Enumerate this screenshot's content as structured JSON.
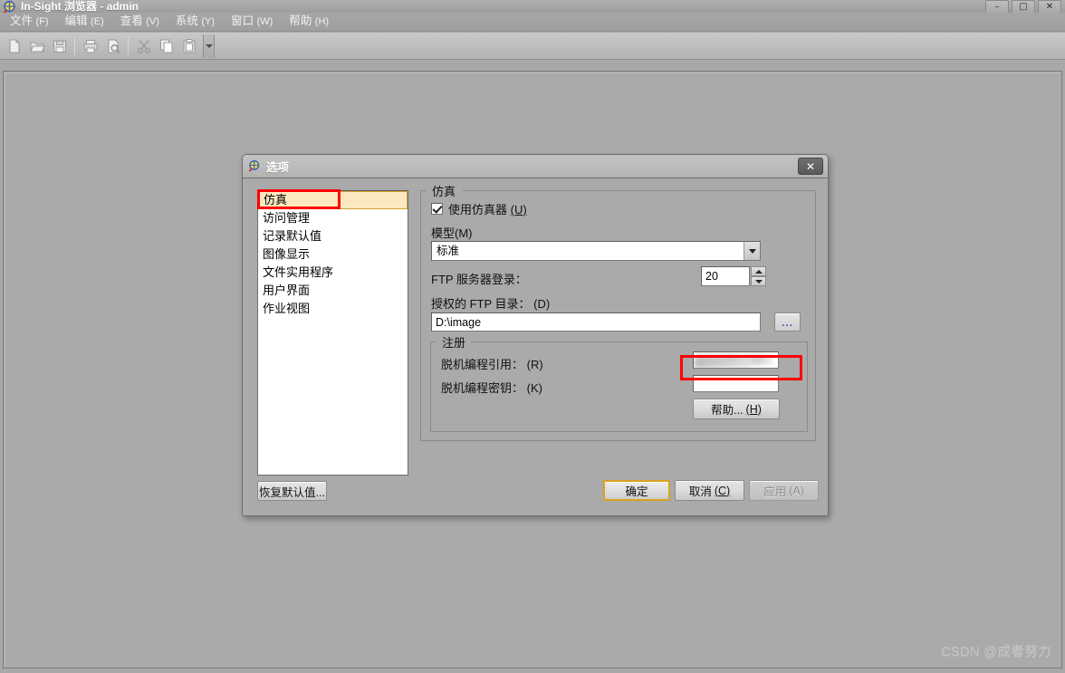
{
  "window": {
    "title": "In-Sight 浏览器 - admin",
    "icon": "insight-app-icon",
    "controls": {
      "minimize": "–",
      "maximize": "□",
      "close": "✕"
    }
  },
  "menubar": {
    "items": [
      {
        "name": "file",
        "label": "文件",
        "accel": "(F)"
      },
      {
        "name": "edit",
        "label": "编辑",
        "accel": "(E)"
      },
      {
        "name": "view",
        "label": "查看",
        "accel": "(V)"
      },
      {
        "name": "system",
        "label": "系统",
        "accel": "(Y)"
      },
      {
        "name": "window",
        "label": "窗口",
        "accel": "(W)"
      },
      {
        "name": "help",
        "label": "帮助",
        "accel": "(H)"
      }
    ]
  },
  "toolbar": {
    "buttons": [
      {
        "name": "new-icon",
        "enabled": false
      },
      {
        "name": "open-folder-icon",
        "enabled": false
      },
      {
        "name": "save-floppy-icon",
        "enabled": false
      },
      {
        "name": "print-icon",
        "enabled": false
      },
      {
        "name": "print-preview-icon",
        "enabled": false
      },
      {
        "name": "cut-scissors-icon",
        "enabled": false
      },
      {
        "name": "copy-icon",
        "enabled": false
      },
      {
        "name": "paste-icon",
        "enabled": false
      }
    ],
    "overflow_icon": "chevron-down-icon"
  },
  "dialog": {
    "title": "选项",
    "icon": "options-icon",
    "close_label": "✕",
    "categories": [
      {
        "label": "仿真",
        "selected": true
      },
      {
        "label": "访问管理",
        "selected": false
      },
      {
        "label": "记录默认值",
        "selected": false
      },
      {
        "label": "图像显示",
        "selected": false
      },
      {
        "label": "文件实用程序",
        "selected": false
      },
      {
        "label": "用户界面",
        "selected": false
      },
      {
        "label": "作业视图",
        "selected": false
      }
    ],
    "simulation_group": {
      "legend": "仿真",
      "use_emulator": {
        "label": "使用仿真器",
        "accel": "(U)",
        "checked": true
      },
      "model": {
        "label": "模型(M)",
        "value": "标准",
        "options": [
          "标准"
        ]
      },
      "ftp_logins": {
        "label": "FTP 服务器登录：",
        "value": "20"
      },
      "ftp_directory": {
        "label": "授权的 FTP 目录：",
        "accel": "(D)",
        "value": "D:\\image",
        "browse_label": "..."
      },
      "registration_group": {
        "legend": "注册",
        "offline_ref": {
          "label": "脱机编程引用：",
          "accel": "(R)",
          "value": "",
          "redacted": true
        },
        "offline_key": {
          "label": "脱机编程密钥：",
          "accel": "(K)",
          "value": ""
        },
        "help_button": {
          "label": "帮助...",
          "accel": "(H)"
        }
      }
    },
    "footer": {
      "restore_defaults": "恢复默认值...",
      "ok": "确定",
      "cancel": "取消",
      "cancel_accel": "(C)",
      "apply": "应用",
      "apply_accel": "(A)",
      "apply_enabled": false
    }
  },
  "annotations": {
    "accent_red": "#ff0000",
    "highlight_bg": "#fde9c0",
    "default_button_border": "#d8a31f",
    "rects": [
      {
        "name": "annot-category-simulation"
      },
      {
        "name": "annot-offline-ref-field"
      }
    ]
  },
  "watermark": {
    "text": "CSDN @成者努力"
  }
}
